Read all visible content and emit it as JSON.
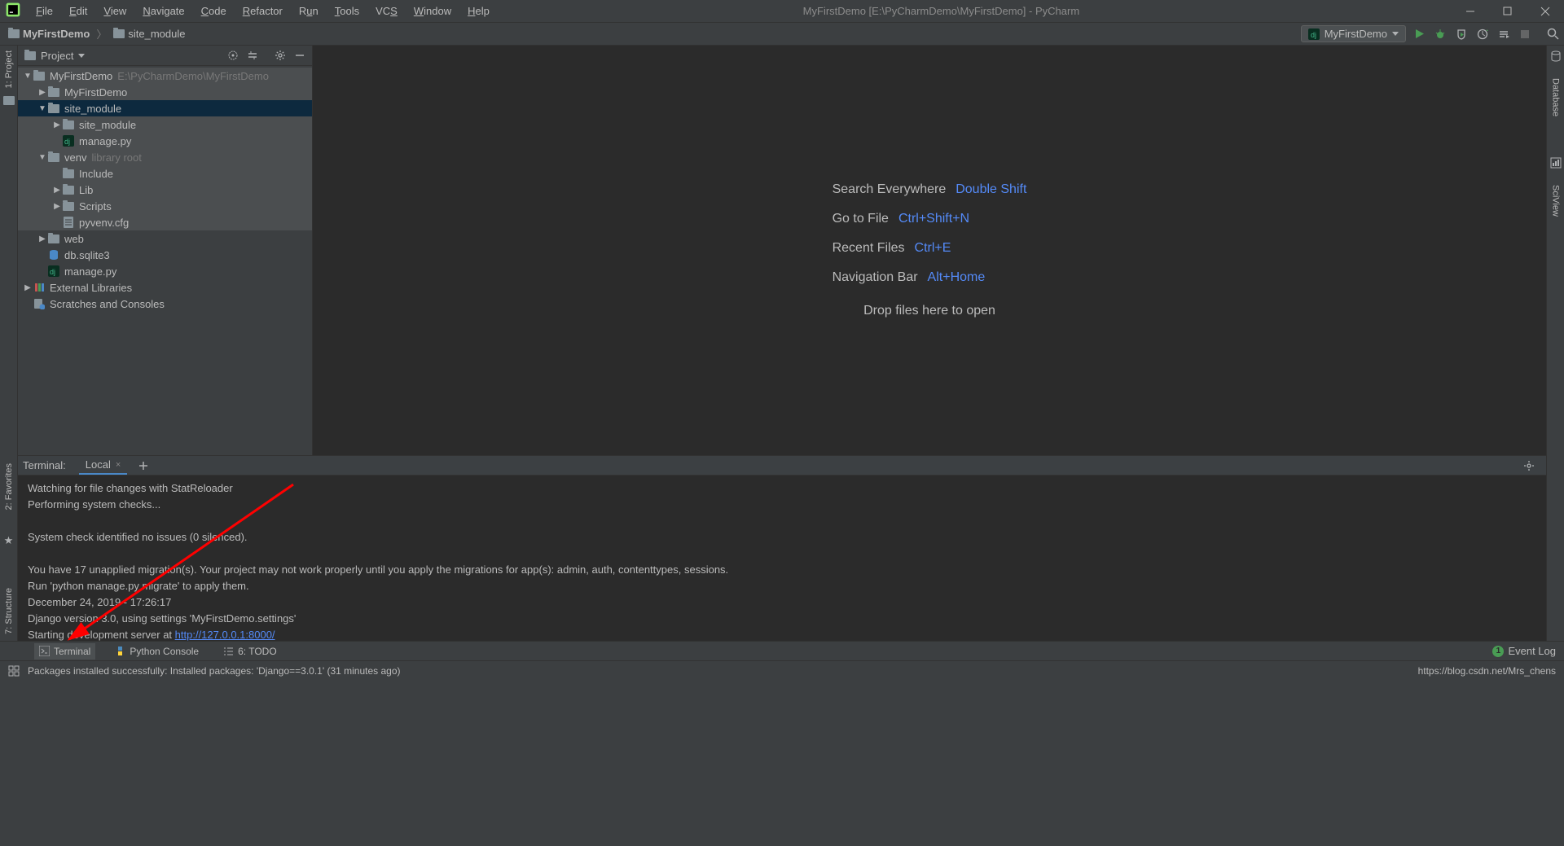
{
  "window": {
    "title": "MyFirstDemo [E:\\PyCharmDemo\\MyFirstDemo] - PyCharm"
  },
  "menus": [
    "File",
    "Edit",
    "View",
    "Navigate",
    "Code",
    "Refactor",
    "Run",
    "Tools",
    "VCS",
    "Window",
    "Help"
  ],
  "breadcrumb": {
    "root_icon": "folder",
    "root": "MyFirstDemo",
    "child_icon": "folder",
    "child": "site_module"
  },
  "run_config": {
    "label": "MyFirstDemo"
  },
  "project_panel": {
    "title": "Project",
    "items": [
      {
        "indent": 0,
        "arrow": "▼",
        "icon": "folder",
        "label": "MyFirstDemo",
        "hint": "E:\\PyCharmDemo\\MyFirstDemo",
        "hl": true
      },
      {
        "indent": 1,
        "arrow": "▶",
        "icon": "folder",
        "label": "MyFirstDemo",
        "hl": true
      },
      {
        "indent": 1,
        "arrow": "▼",
        "icon": "folder",
        "label": "site_module",
        "selected": true
      },
      {
        "indent": 2,
        "arrow": "▶",
        "icon": "folder",
        "label": "site_module",
        "hl": true
      },
      {
        "indent": 2,
        "arrow": "",
        "icon": "django",
        "label": "manage.py",
        "hl": true
      },
      {
        "indent": 1,
        "arrow": "▼",
        "icon": "folder",
        "label": "venv",
        "hint": "library root",
        "hl": true
      },
      {
        "indent": 2,
        "arrow": "",
        "icon": "folder",
        "label": "Include",
        "hl": true
      },
      {
        "indent": 2,
        "arrow": "▶",
        "icon": "folder",
        "label": "Lib",
        "hl": true
      },
      {
        "indent": 2,
        "arrow": "▶",
        "icon": "folder",
        "label": "Scripts",
        "hl": true
      },
      {
        "indent": 2,
        "arrow": "",
        "icon": "file",
        "label": "pyvenv.cfg",
        "hl": true
      },
      {
        "indent": 1,
        "arrow": "▶",
        "icon": "folder",
        "label": "web"
      },
      {
        "indent": 1,
        "arrow": "",
        "icon": "db",
        "label": "db.sqlite3"
      },
      {
        "indent": 1,
        "arrow": "",
        "icon": "django",
        "label": "manage.py"
      },
      {
        "indent": 0,
        "arrow": "▶",
        "icon": "lib",
        "label": "External Libraries"
      },
      {
        "indent": 0,
        "arrow": "",
        "icon": "scratch",
        "label": "Scratches and Consoles"
      }
    ]
  },
  "editor_hints": [
    {
      "label": "Search Everywhere",
      "shortcut": "Double Shift"
    },
    {
      "label": "Go to File",
      "shortcut": "Ctrl+Shift+N"
    },
    {
      "label": "Recent Files",
      "shortcut": "Ctrl+E"
    },
    {
      "label": "Navigation Bar",
      "shortcut": "Alt+Home"
    }
  ],
  "editor_drop": "Drop files here to open",
  "left_rail": {
    "project": "1: Project"
  },
  "right_rail": {
    "database": "Database",
    "sciview": "SciView"
  },
  "left_rail_bottom": {
    "favorites": "2: Favorites",
    "structure": "7: Structure"
  },
  "terminal": {
    "label": "Terminal:",
    "tab": "Local",
    "lines": [
      "Watching for file changes with StatReloader",
      "Performing system checks...",
      "",
      "System check identified no issues (0 silenced).",
      "",
      "You have 17 unapplied migration(s). Your project may not work properly until you apply the migrations for app(s): admin, auth, contenttypes, sessions.",
      "Run 'python manage.py migrate' to apply them.",
      "December 24, 2019 - 17:26:17",
      "Django version 3.0, using settings 'MyFirstDemo.settings'"
    ],
    "last_line_prefix": "Starting development server at ",
    "last_line_link": "http://127.0.0.1:8000/"
  },
  "bottom_tools": {
    "terminal": "Terminal",
    "python_console": "Python Console",
    "todo": "6: TODO",
    "event_log": "Event Log",
    "event_badge": "1"
  },
  "status": {
    "message": "Packages installed successfully: Installed packages: 'Django==3.0.1' (31 minutes ago)",
    "url": "https://blog.csdn.net/Mrs_chens"
  }
}
